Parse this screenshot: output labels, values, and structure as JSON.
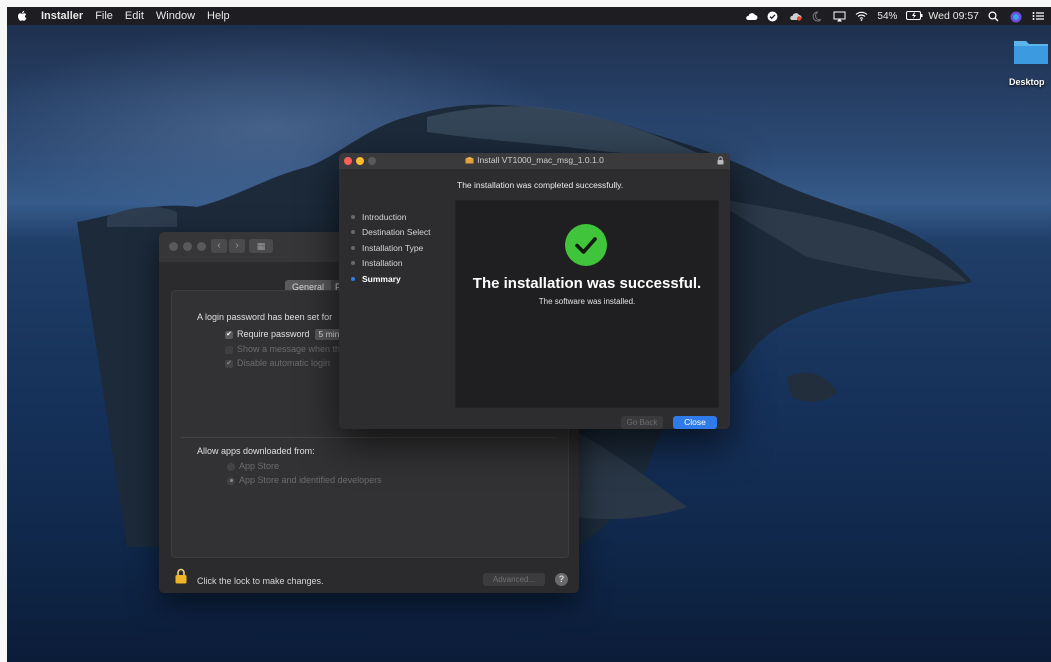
{
  "menubar": {
    "app_name": "Installer",
    "items": [
      "File",
      "Edit",
      "Window",
      "Help"
    ],
    "battery": "54%",
    "clock": "Wed 09:57"
  },
  "desktop": {
    "folder_label": "Desktop"
  },
  "security_window": {
    "tab_general": "General",
    "tab_second": "Fi",
    "login_password_text": "A login password has been set for",
    "require_password_label": "Require password",
    "require_password_value": "5 minu",
    "show_message_label": "Show a message when the",
    "disable_login_label": "Disable automatic login",
    "allow_apps_label": "Allow apps downloaded from:",
    "option_app_store": "App Store",
    "option_identified": "App Store and identified developers",
    "lock_text": "Click the lock to make changes.",
    "advanced_button": "Advanced...",
    "help_button": "?"
  },
  "installer_window": {
    "title": "Install VT1000_mac_msg_1.0.1.0",
    "header": "The installation was completed successfully.",
    "steps": [
      {
        "label": "Introduction"
      },
      {
        "label": "Destination Select"
      },
      {
        "label": "Installation Type"
      },
      {
        "label": "Installation"
      },
      {
        "label": "Summary"
      }
    ],
    "success_title": "The installation was successful.",
    "success_subtitle": "The software was installed.",
    "go_back_button": "Go Back",
    "close_button": "Close"
  },
  "colors": {
    "accent_blue": "#2f7bea",
    "success_green": "#3fc43b",
    "lock_gold": "#f0b429"
  }
}
